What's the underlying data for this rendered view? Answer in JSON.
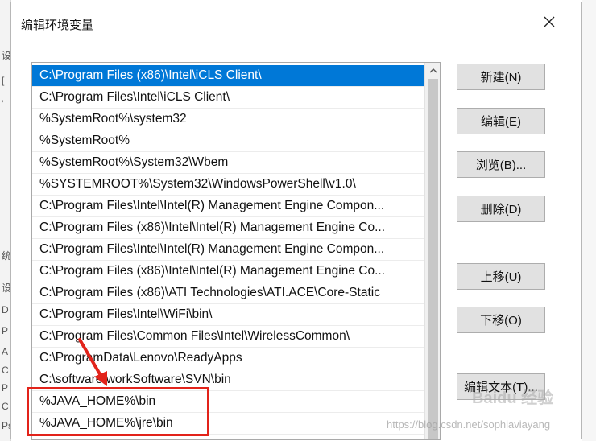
{
  "background": {
    "edge_fragments": [
      "设",
      "[",
      "'",
      "统",
      "设",
      "D",
      "P",
      "A",
      "C",
      "P",
      "C",
      "Ps"
    ]
  },
  "dialog": {
    "title": "编辑环境变量",
    "close_icon": "close-icon"
  },
  "list": {
    "items": [
      "C:\\Program Files (x86)\\Intel\\iCLS Client\\",
      "C:\\Program Files\\Intel\\iCLS Client\\",
      "%SystemRoot%\\system32",
      "%SystemRoot%",
      "%SystemRoot%\\System32\\Wbem",
      "%SYSTEMROOT%\\System32\\WindowsPowerShell\\v1.0\\",
      "C:\\Program Files\\Intel\\Intel(R) Management Engine Compon...",
      "C:\\Program Files (x86)\\Intel\\Intel(R) Management Engine Co...",
      "C:\\Program Files\\Intel\\Intel(R) Management Engine Compon...",
      "C:\\Program Files (x86)\\Intel\\Intel(R) Management Engine Co...",
      "C:\\Program Files (x86)\\ATI Technologies\\ATI.ACE\\Core-Static",
      "C:\\Program Files\\Intel\\WiFi\\bin\\",
      "C:\\Program Files\\Common Files\\Intel\\WirelessCommon\\",
      "C:\\ProgramData\\Lenovo\\ReadyApps",
      "C:\\software\\workSoftware\\SVN\\bin",
      "%JAVA_HOME%\\bin",
      "%JAVA_HOME%\\jre\\bin"
    ],
    "selected_index": 0
  },
  "buttons": {
    "new": "新建(N)",
    "edit": "编辑(E)",
    "browse": "浏览(B)...",
    "delete": "删除(D)",
    "move_up": "上移(U)",
    "move_down": "下移(O)",
    "edit_text": "编辑文本(T)..."
  },
  "watermarks": {
    "baidu": "Baidu 经验",
    "csdn": "https://blog.csdn.net/sophiaviayang"
  },
  "colors": {
    "selection": "#0078d7",
    "annotation": "#e2231a"
  }
}
